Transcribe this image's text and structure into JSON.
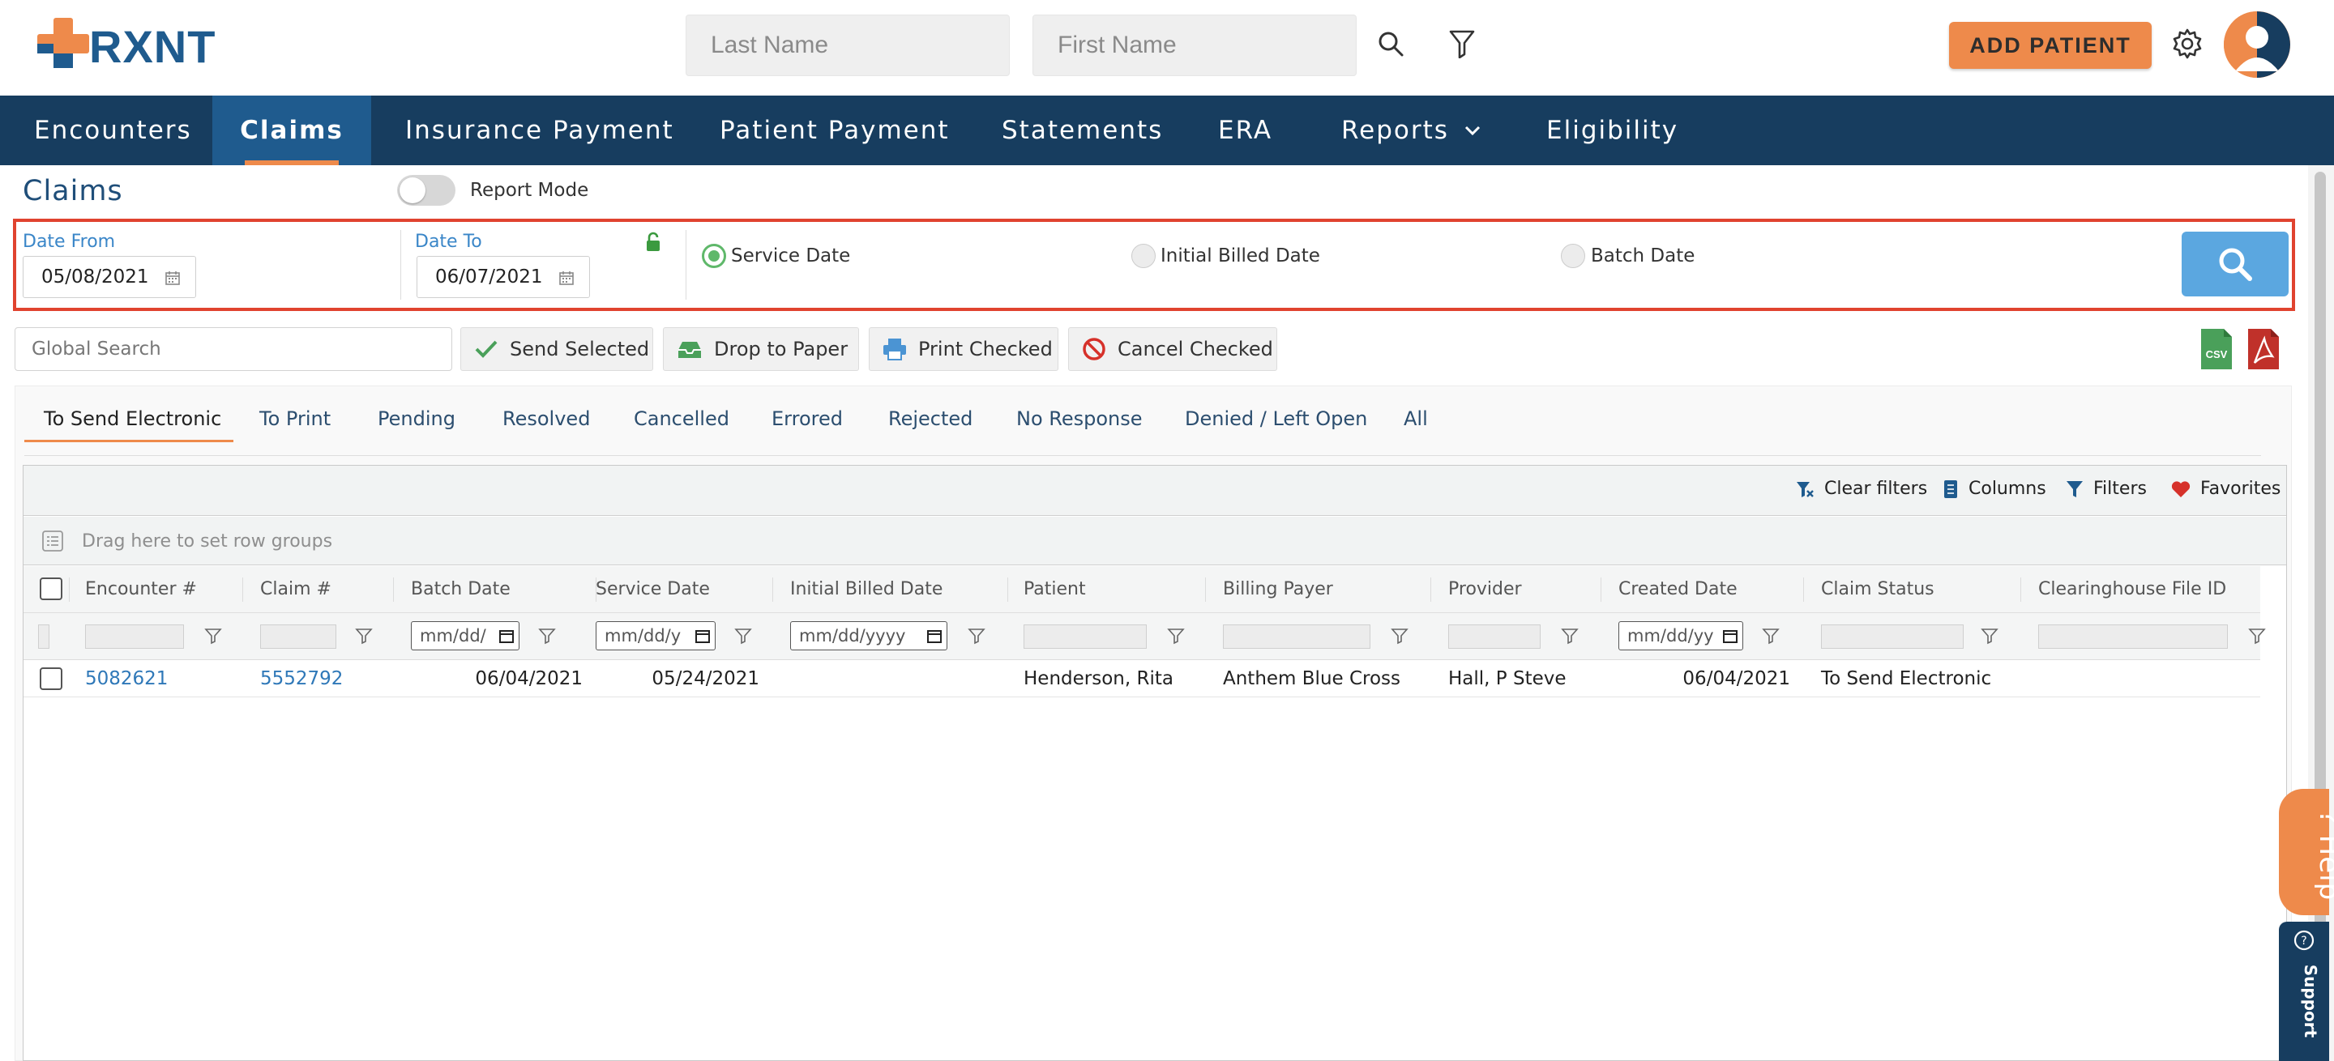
{
  "app": {
    "logo_text": "RXNT"
  },
  "header": {
    "last_name_placeholder": "Last Name",
    "first_name_placeholder": "First Name",
    "add_patient_label": "ADD PATIENT"
  },
  "nav": {
    "items": [
      {
        "label": "Encounters"
      },
      {
        "label": "Claims",
        "active": true
      },
      {
        "label": "Insurance Payment"
      },
      {
        "label": "Patient Payment"
      },
      {
        "label": "Statements"
      },
      {
        "label": "ERA"
      },
      {
        "label": "Reports"
      },
      {
        "label": "Eligibility"
      }
    ]
  },
  "page": {
    "title": "Claims",
    "report_mode_label": "Report Mode",
    "report_mode_on": false
  },
  "filters": {
    "date_from_label": "Date From",
    "date_from_value": "05/08/2021",
    "date_to_label": "Date To",
    "date_to_value": "06/07/2021",
    "date_type_options": [
      "Service Date",
      "Initial Billed Date",
      "Batch Date"
    ],
    "date_type_selected": "Service Date"
  },
  "actions": {
    "global_search_placeholder": "Global Search",
    "send_selected": "Send Selected",
    "drop_to_paper": "Drop to Paper",
    "print_checked": "Print Checked",
    "cancel_checked": "Cancel Checked"
  },
  "tabs": [
    {
      "label": "To Send Electronic",
      "active": true
    },
    {
      "label": "To Print"
    },
    {
      "label": "Pending"
    },
    {
      "label": "Resolved"
    },
    {
      "label": "Cancelled"
    },
    {
      "label": "Errored"
    },
    {
      "label": "Rejected"
    },
    {
      "label": "No Response"
    },
    {
      "label": "Denied / Left Open"
    },
    {
      "label": "All"
    }
  ],
  "grid": {
    "toolbar": {
      "clear_filters": "Clear filters",
      "columns": "Columns",
      "filters": "Filters",
      "favorites": "Favorites"
    },
    "group_placeholder": "Drag here to set row groups",
    "columns": [
      "Encounter #",
      "Claim #",
      "Batch Date",
      "Service Date",
      "Initial Billed Date",
      "Patient",
      "Billing Payer",
      "Provider",
      "Created Date",
      "Claim Status",
      "Clearinghouse File ID"
    ],
    "date_filter_placeholders": {
      "batch_date": "mm/dd/",
      "service_date": "mm/dd/y",
      "initial_billed_date": "mm/dd/yyyy",
      "created_date": "mm/dd/yy"
    },
    "rows": [
      {
        "encounter": "5082621",
        "claim": "5552792",
        "batch_date": "06/04/2021",
        "service_date": "05/24/2021",
        "initial_billed_date": "",
        "patient": "Henderson, Rita",
        "billing_payer": "Anthem Blue Cross",
        "provider": "Hall, P Steve",
        "created_date": "06/04/2021",
        "claim_status": "To Send Electronic",
        "clearinghouse_file_id": ""
      }
    ]
  },
  "side": {
    "help_label": "? Help",
    "support_label": "Support"
  },
  "colors": {
    "navy": "#173d5f",
    "nav_active": "#1f5b8e",
    "accent_orange": "#ee8a4b",
    "link_blue": "#2f78b8",
    "highlight_red": "#e0432f",
    "radio_green": "#5fb86a"
  }
}
